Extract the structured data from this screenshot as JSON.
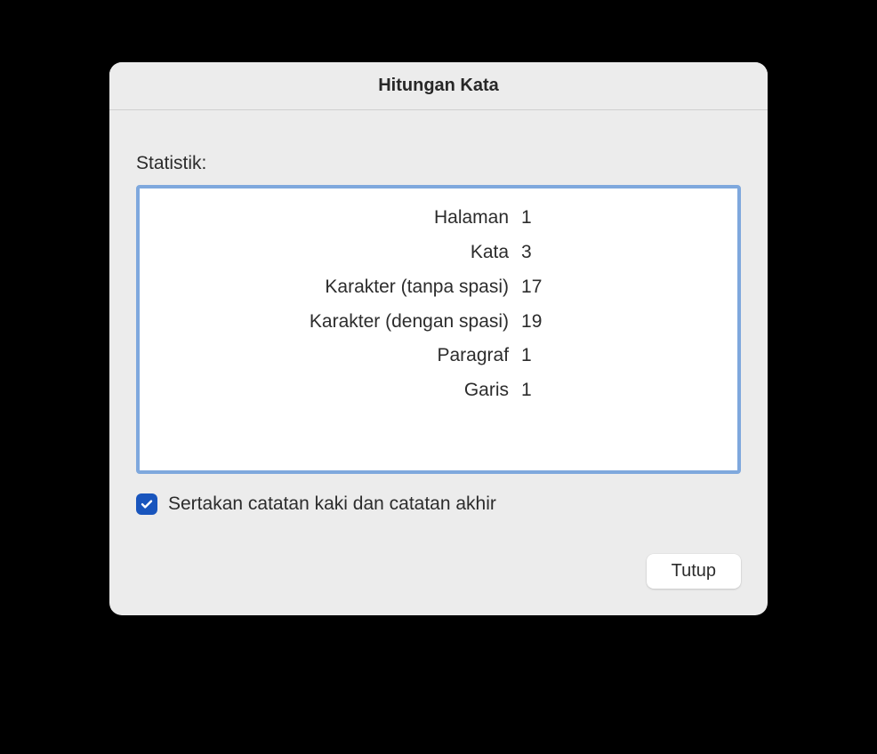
{
  "dialog": {
    "title": "Hitungan Kata",
    "section_label": "Statistik:",
    "stats": [
      {
        "label": "Halaman",
        "value": "1"
      },
      {
        "label": "Kata",
        "value": "3"
      },
      {
        "label": "Karakter (tanpa spasi)",
        "value": "17"
      },
      {
        "label": "Karakter (dengan spasi)",
        "value": "19"
      },
      {
        "label": "Paragraf",
        "value": "1"
      },
      {
        "label": "Garis",
        "value": "1"
      }
    ],
    "checkbox": {
      "checked": true,
      "label": "Sertakan catatan kaki dan catatan akhir"
    },
    "close_button": "Tutup"
  },
  "colors": {
    "accent": "#1955bd",
    "focus_ring": "#7fa8dd",
    "dialog_bg": "#ececec"
  }
}
